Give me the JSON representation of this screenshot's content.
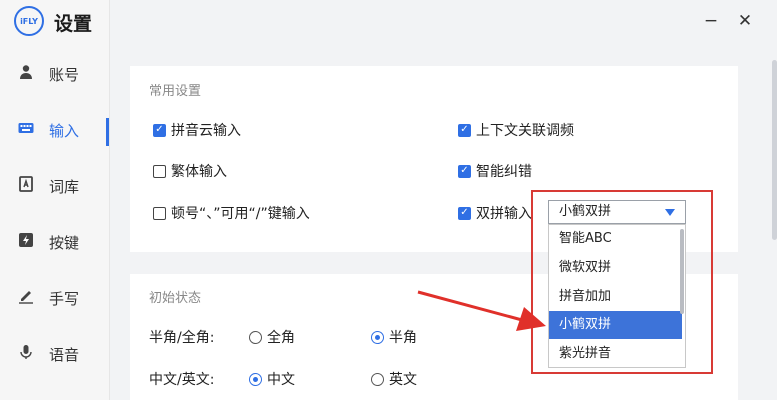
{
  "app": {
    "logo_text": "iFLY",
    "title": "设置"
  },
  "window": {
    "minimize": "−",
    "close": "✕"
  },
  "sidebar": {
    "items": [
      {
        "label": "账号",
        "icon": "person-icon"
      },
      {
        "label": "输入",
        "icon": "keyboard-icon"
      },
      {
        "label": "词库",
        "icon": "dictionary-icon"
      },
      {
        "label": "按键",
        "icon": "key-icon"
      },
      {
        "label": "手写",
        "icon": "pen-icon"
      },
      {
        "label": "语音",
        "icon": "microphone-icon"
      }
    ],
    "active": "输入"
  },
  "common": {
    "title": "常用设置",
    "options": {
      "cloud": {
        "label": "拼音云输入",
        "checked": true
      },
      "context": {
        "label": "上下文关联调频",
        "checked": true
      },
      "traditional": {
        "label": "繁体输入",
        "checked": false
      },
      "correction": {
        "label": "智能纠错",
        "checked": true
      },
      "punct": {
        "label": "顿号“、”可用“/”键输入",
        "checked": false
      },
      "double": {
        "label": "双拼输入",
        "checked": true
      }
    }
  },
  "initial": {
    "title": "初始状态",
    "width": {
      "label": "半角/全角:",
      "full": "全角",
      "half": "半角",
      "selected": "半角"
    },
    "lang": {
      "label": "中文/英文:",
      "chinese": "中文",
      "english": "英文",
      "selected": "中文"
    }
  },
  "double_pinyin": {
    "selected": "小鹤双拼",
    "options": [
      "智能ABC",
      "微软双拼",
      "拼音加加",
      "小鹤双拼",
      "紫光拼音"
    ]
  },
  "colors": {
    "accent": "#2f6fe4",
    "highlight": "#d83a35",
    "selected_bg": "#3d73d9"
  }
}
